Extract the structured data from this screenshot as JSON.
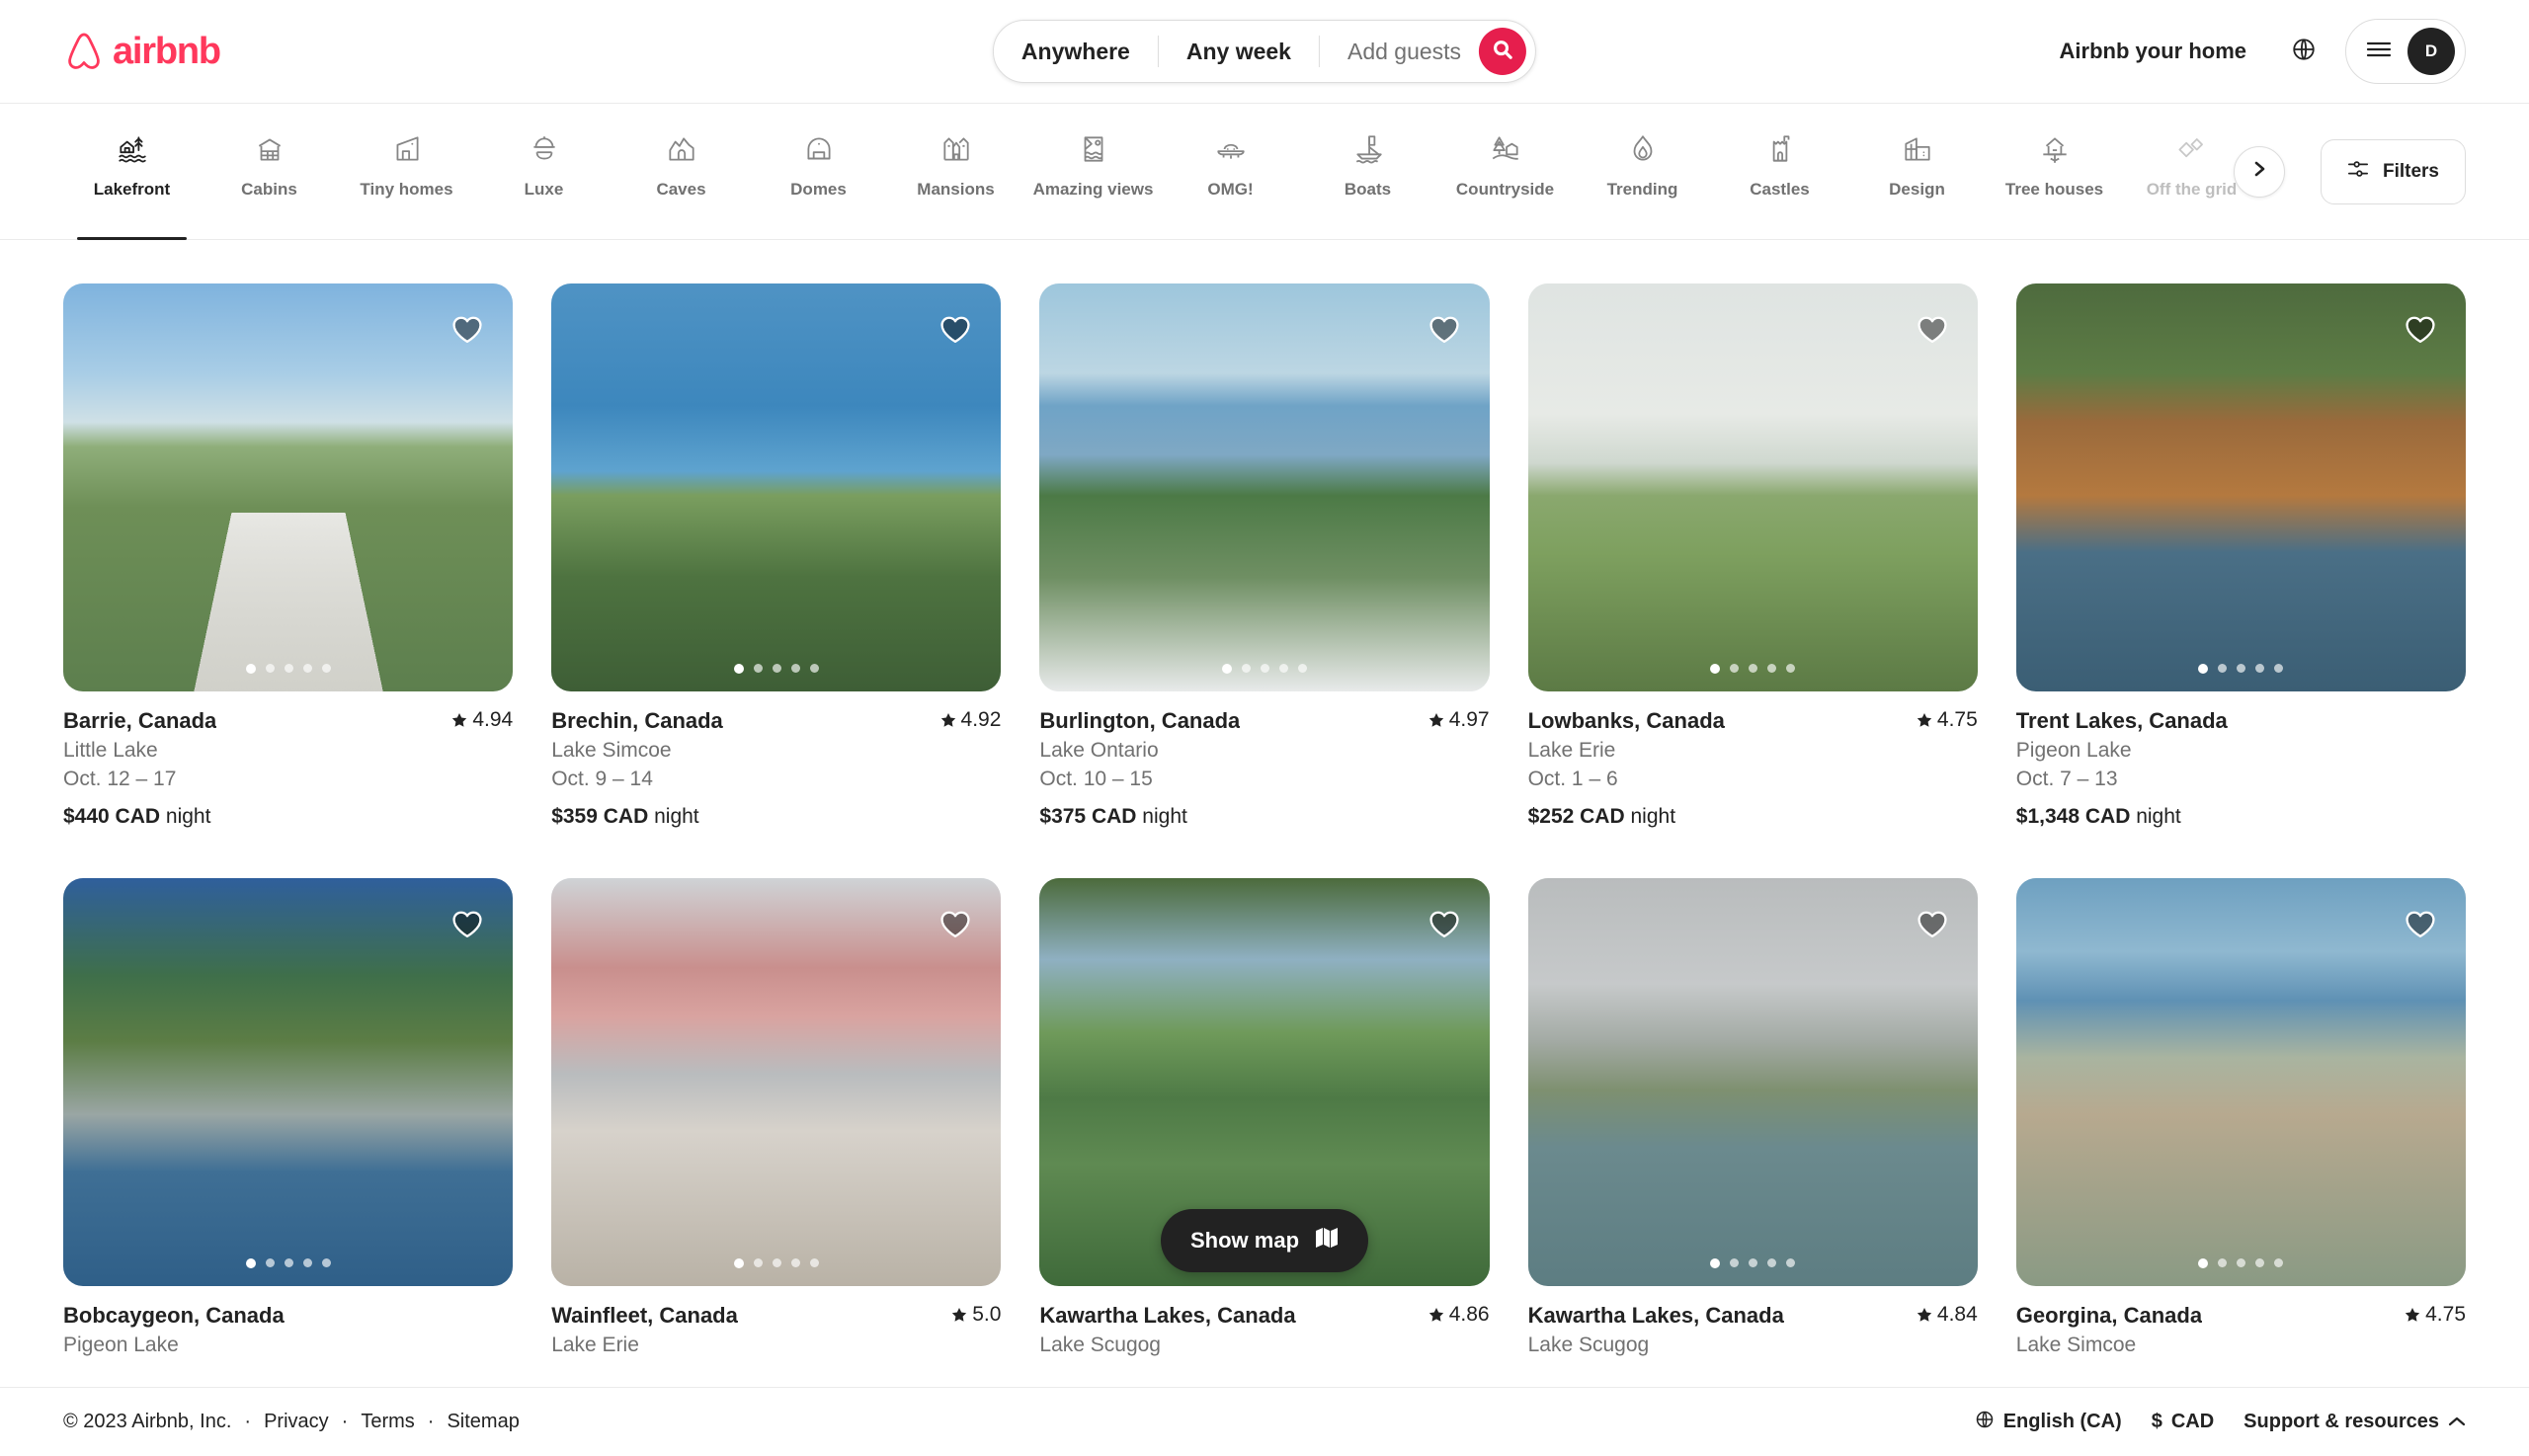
{
  "header": {
    "brand": "airbnb",
    "host_link": "Airbnb your home",
    "avatar_initial": "D",
    "search": {
      "where": "Anywhere",
      "when": "Any week",
      "guests_placeholder": "Add guests"
    }
  },
  "categories": {
    "active": "Lakefront",
    "items": [
      {
        "label": "Lakefront",
        "icon": "lakefront-icon"
      },
      {
        "label": "Cabins",
        "icon": "cabin-icon"
      },
      {
        "label": "Tiny homes",
        "icon": "tiny-home-icon"
      },
      {
        "label": "Luxe",
        "icon": "luxe-icon"
      },
      {
        "label": "Caves",
        "icon": "cave-icon"
      },
      {
        "label": "Domes",
        "icon": "dome-icon"
      },
      {
        "label": "Mansions",
        "icon": "mansion-icon"
      },
      {
        "label": "Amazing views",
        "icon": "amazing-views-icon"
      },
      {
        "label": "OMG!",
        "icon": "omg-icon"
      },
      {
        "label": "Boats",
        "icon": "boat-icon"
      },
      {
        "label": "Countryside",
        "icon": "countryside-icon"
      },
      {
        "label": "Trending",
        "icon": "flame-icon"
      },
      {
        "label": "Castles",
        "icon": "castle-icon"
      },
      {
        "label": "Design",
        "icon": "design-icon"
      },
      {
        "label": "Tree houses",
        "icon": "tree-house-icon"
      },
      {
        "label": "Off the grid",
        "icon": "off-the-grid-icon"
      }
    ],
    "next_label": "›",
    "filters_label": "Filters"
  },
  "listings": [
    {
      "title": "Barrie, Canada",
      "rating": "4.94",
      "subtitle": "Little Lake",
      "dates": "Oct. 12 – 17",
      "price": "$440 CAD",
      "price_unit": "night",
      "photo": "p1",
      "dots": 5,
      "active_dot": 0
    },
    {
      "title": "Brechin, Canada",
      "rating": "4.92",
      "subtitle": "Lake Simcoe",
      "dates": "Oct. 9 – 14",
      "price": "$359 CAD",
      "price_unit": "night",
      "photo": "p2",
      "dots": 5,
      "active_dot": 0
    },
    {
      "title": "Burlington, Canada",
      "rating": "4.97",
      "subtitle": "Lake Ontario",
      "dates": "Oct. 10 – 15",
      "price": "$375 CAD",
      "price_unit": "night",
      "photo": "p3",
      "dots": 5,
      "active_dot": 0
    },
    {
      "title": "Lowbanks, Canada",
      "rating": "4.75",
      "subtitle": "Lake Erie",
      "dates": "Oct. 1 – 6",
      "price": "$252 CAD",
      "price_unit": "night",
      "photo": "p4",
      "dots": 5,
      "active_dot": 0
    },
    {
      "title": "Trent Lakes, Canada",
      "rating": "",
      "subtitle": "Pigeon Lake",
      "dates": "Oct. 7 – 13",
      "price": "$1,348 CAD",
      "price_unit": "night",
      "photo": "p5",
      "dots": 5,
      "active_dot": 0
    },
    {
      "title": "Bobcaygeon, Canada",
      "rating": "",
      "subtitle": "Pigeon Lake",
      "dates": "",
      "price": "",
      "price_unit": "",
      "photo": "p6",
      "dots": 5,
      "active_dot": 0
    },
    {
      "title": "Wainfleet, Canada",
      "rating": "5.0",
      "subtitle": "Lake Erie",
      "dates": "",
      "price": "",
      "price_unit": "",
      "photo": "p7",
      "dots": 5,
      "active_dot": 0
    },
    {
      "title": "Kawartha Lakes, Canada",
      "rating": "4.86",
      "subtitle": "Lake Scugog",
      "dates": "",
      "price": "",
      "price_unit": "",
      "photo": "p8",
      "dots": 0,
      "active_dot": 0
    },
    {
      "title": "Kawartha Lakes, Canada",
      "rating": "4.84",
      "subtitle": "Lake Scugog",
      "dates": "",
      "price": "",
      "price_unit": "",
      "photo": "p9",
      "dots": 5,
      "active_dot": 0
    },
    {
      "title": "Georgina, Canada",
      "rating": "4.75",
      "subtitle": "Lake Simcoe",
      "dates": "",
      "price": "",
      "price_unit": "",
      "photo": "p10",
      "dots": 5,
      "active_dot": 0
    }
  ],
  "show_map_label": "Show map",
  "footer": {
    "copyright": "© 2023 Airbnb, Inc.",
    "links": [
      "Privacy",
      "Terms",
      "Sitemap"
    ],
    "language": "English (CA)",
    "currency_symbol": "$",
    "currency": "CAD",
    "support": "Support & resources"
  },
  "colors": {
    "brand": "#FF385C",
    "search_button": "#e61e4d",
    "text": "#222222",
    "muted": "#717171",
    "border": "#dddddd"
  }
}
